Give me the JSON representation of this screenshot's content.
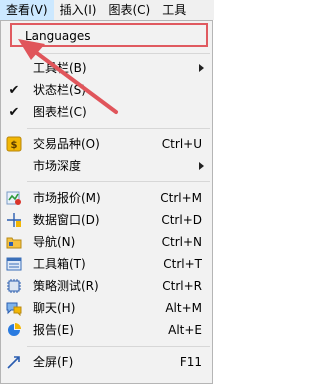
{
  "menubar": {
    "items": [
      {
        "label": "查看(V)"
      },
      {
        "label": "插入(I)"
      },
      {
        "label": "图表(C)"
      },
      {
        "label": "工具"
      }
    ]
  },
  "menu": {
    "languages": {
      "label": "Languages"
    },
    "toolbar": {
      "label": "工具栏(B)"
    },
    "statusbar": {
      "label": "状态栏(S)"
    },
    "chartbar": {
      "label": "图表栏(C)"
    },
    "symbols": {
      "label": "交易品种(O)",
      "shortcut": "Ctrl+U"
    },
    "depth": {
      "label": "市场深度"
    },
    "market_watch": {
      "label": "市场报价(M)",
      "shortcut": "Ctrl+M"
    },
    "data_window": {
      "label": "数据窗口(D)",
      "shortcut": "Ctrl+D"
    },
    "navigator": {
      "label": "导航(N)",
      "shortcut": "Ctrl+N"
    },
    "toolbox": {
      "label": "工具箱(T)",
      "shortcut": "Ctrl+T"
    },
    "strategy_tester": {
      "label": "策略测试(R)",
      "shortcut": "Ctrl+R"
    },
    "chat": {
      "label": "聊天(H)",
      "shortcut": "Alt+M"
    },
    "reports": {
      "label": "报告(E)",
      "shortcut": "Alt+E"
    },
    "fullscreen": {
      "label": "全屏(F)",
      "shortcut": "F11"
    }
  },
  "colors": {
    "highlight_border": "#e05a60",
    "annotation_arrow": "#e0555b",
    "active_menu": "#cce8ff"
  }
}
